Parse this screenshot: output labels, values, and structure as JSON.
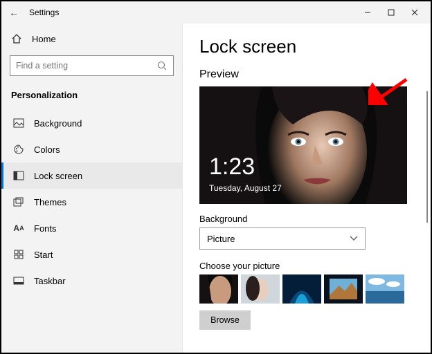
{
  "titlebar": {
    "back_icon": "←",
    "title": "Settings"
  },
  "sidebar": {
    "home": "Home",
    "search_placeholder": "Find a setting",
    "category": "Personalization",
    "items": [
      {
        "icon": "image-icon",
        "label": "Background"
      },
      {
        "icon": "palette-icon",
        "label": "Colors"
      },
      {
        "icon": "lock-icon",
        "label": "Lock screen",
        "selected": true
      },
      {
        "icon": "themes-icon",
        "label": "Themes"
      },
      {
        "icon": "fonts-icon",
        "label": "Fonts"
      },
      {
        "icon": "start-icon",
        "label": "Start"
      },
      {
        "icon": "taskbar-icon",
        "label": "Taskbar"
      }
    ]
  },
  "content": {
    "heading": "Lock screen",
    "preview_label": "Preview",
    "lock_time": "1:23",
    "lock_date": "Tuesday, August 27",
    "bg_label": "Background",
    "bg_value": "Picture",
    "choose_label": "Choose your picture",
    "browse": "Browse"
  }
}
